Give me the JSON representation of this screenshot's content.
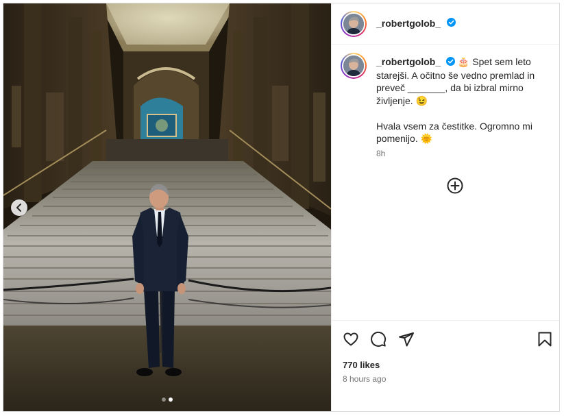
{
  "post": {
    "username": "_robertgolob_",
    "caption_lines": [
      "Spet sem leto",
      "starejši. A očitno še vedno premlad in",
      "preveč _______, da bi izbral mirno",
      "življenje. 😉",
      "",
      "Hvala vsem za čestitke. Ogromno mi",
      "pomenijo. 🌞"
    ],
    "caption_emoji": "🎂",
    "relative_time": "8h",
    "likes": "770 likes",
    "posted_ago": "8 hours ago"
  },
  "carousel": {
    "slide_count": 2,
    "active_index": 1
  },
  "icons": {
    "verified": "verified-badge-icon",
    "prev": "chevron-left-icon",
    "add": "add-circle-icon",
    "like": "heart-icon",
    "comment": "comment-icon",
    "share": "send-icon",
    "save": "bookmark-icon"
  },
  "colors": {
    "verified": "#0095f6",
    "text": "#262626",
    "muted": "#737373"
  }
}
